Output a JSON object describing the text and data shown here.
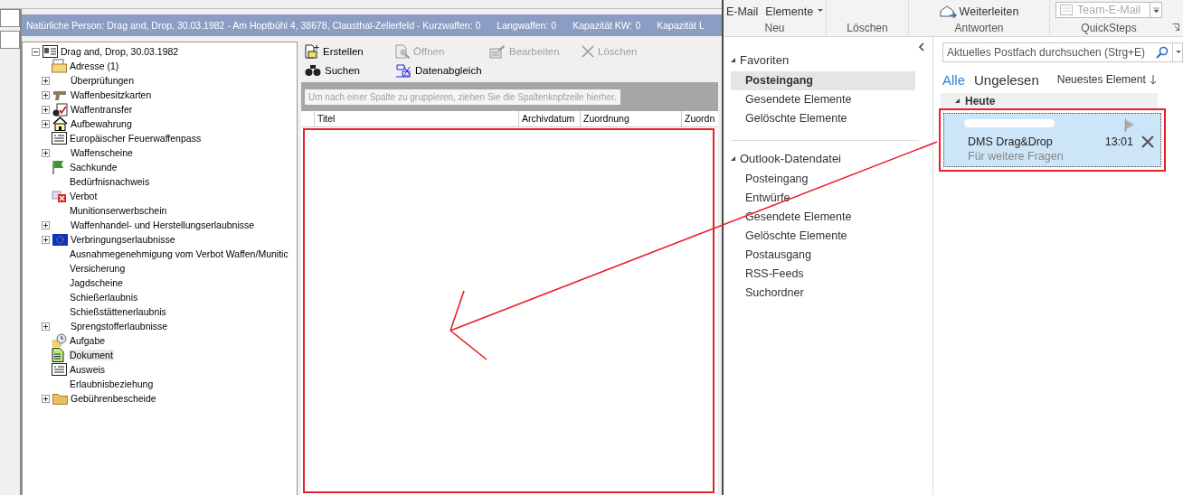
{
  "header_bar": {
    "text": "Natürliche Person: Drag and, Drop, 30.03.1982 - Am Hoptbühl 4, 38678, Clausthal-Zellerfeld - Kurzwaffen: 0",
    "extras": [
      "Langwaffen: 0",
      "Kapazität KW: 0",
      "Kapazität L"
    ]
  },
  "tree": {
    "label": "Drag and, Drop, 30.03.1982",
    "expanded": true,
    "children": [
      {
        "label": "Adresse (1)",
        "kind": "address",
        "expandable": false,
        "selected": false
      },
      {
        "label": "Überprüfungen",
        "kind": "none",
        "expandable": true,
        "selected": false
      },
      {
        "label": "Waffenbesitzkarten",
        "kind": "gun",
        "expandable": true,
        "selected": false
      },
      {
        "label": "Waffentransfer",
        "kind": "transfer",
        "expandable": true,
        "selected": false
      },
      {
        "label": "Aufbewahrung",
        "kind": "house",
        "expandable": true,
        "selected": false
      },
      {
        "label": "Europäischer Feuerwaffenpass",
        "kind": "card",
        "expandable": false,
        "selected": false
      },
      {
        "label": "Waffenscheine",
        "kind": "none",
        "expandable": true,
        "selected": false
      },
      {
        "label": "Sachkunde",
        "kind": "flag",
        "expandable": false,
        "selected": false
      },
      {
        "label": "Bedürfnisnachweis",
        "kind": "none",
        "expandable": false,
        "selected": false
      },
      {
        "label": "Verbot",
        "kind": "ban",
        "expandable": false,
        "selected": false
      },
      {
        "label": "Munitionserwerbschein",
        "kind": "none",
        "expandable": false,
        "selected": false
      },
      {
        "label": "Waffenhandel- und Herstellungserlaubnisse",
        "kind": "none",
        "expandable": true,
        "selected": false
      },
      {
        "label": "Verbringungserlaubnisse",
        "kind": "eu",
        "expandable": true,
        "selected": false
      },
      {
        "label": "Ausnahmegenehmigung vom Verbot Waffen/Munitic",
        "kind": "none",
        "expandable": false,
        "selected": false
      },
      {
        "label": "Versicherung",
        "kind": "none",
        "expandable": false,
        "selected": false
      },
      {
        "label": "Jagdscheine",
        "kind": "none",
        "expandable": false,
        "selected": false
      },
      {
        "label": "Schießerlaubnis",
        "kind": "none",
        "expandable": false,
        "selected": false
      },
      {
        "label": "Schießstättenerlaubnis",
        "kind": "none",
        "expandable": false,
        "selected": false
      },
      {
        "label": "Sprengstofferlaubnisse",
        "kind": "none",
        "expandable": true,
        "selected": false
      },
      {
        "label": "Aufgabe",
        "kind": "task",
        "expandable": false,
        "selected": false
      },
      {
        "label": "Dokument",
        "kind": "document",
        "expandable": false,
        "selected": true
      },
      {
        "label": "Ausweis",
        "kind": "card",
        "expandable": false,
        "selected": false
      },
      {
        "label": "Erlaubnisbeziehung",
        "kind": "none",
        "expandable": false,
        "selected": false
      },
      {
        "label": "Gebührenbescheide",
        "kind": "folder",
        "expandable": true,
        "selected": false
      }
    ]
  },
  "toolbar": [
    {
      "label": "Erstellen",
      "kind": "create",
      "disabled": false
    },
    {
      "label": "Öffnen",
      "kind": "open",
      "disabled": true
    },
    {
      "label": "Bearbeiten",
      "kind": "edit",
      "disabled": true
    },
    {
      "label": "Löschen",
      "kind": "delete",
      "disabled": true
    },
    {
      "label": "Suchen",
      "kind": "search",
      "disabled": false
    },
    {
      "label": "Datenabgleich",
      "kind": "sync",
      "disabled": false
    }
  ],
  "grid": {
    "group_hint": "Um nach einer Spalte zu gruppieren, ziehen Sie die Spaltenkopfzeile hierher.",
    "columns": [
      "Titel",
      "Archivdatum",
      "Zuordnung",
      "Zuordn"
    ]
  },
  "ribbon": {
    "groups": [
      {
        "label": "Neu",
        "buttons": [
          {
            "label": "E-Mail",
            "dropdown": false
          },
          {
            "label": "Elemente",
            "dropdown": true
          }
        ]
      },
      {
        "label": "Löschen"
      },
      {
        "label": "Antworten",
        "buttons": [
          {
            "label": "Weiterleiten",
            "dropdown": false
          }
        ]
      },
      {
        "label": "QuickSteps",
        "field": "Team-E-Mail"
      }
    ]
  },
  "folders": {
    "sections": [
      {
        "title": "Favoriten",
        "items": [
          {
            "label": "Posteingang",
            "selected": true
          },
          {
            "label": "Gesendete Elemente",
            "selected": false
          },
          {
            "label": "Gelöschte Elemente",
            "selected": false
          }
        ]
      },
      {
        "title": "Outlook-Datendatei",
        "items": [
          {
            "label": "Posteingang",
            "selected": false
          },
          {
            "label": "Entwürfe",
            "selected": false
          },
          {
            "label": "Gesendete Elemente",
            "selected": false
          },
          {
            "label": "Gelöschte Elemente",
            "selected": false
          },
          {
            "label": "Postausgang",
            "selected": false
          },
          {
            "label": "RSS-Feeds",
            "selected": false
          },
          {
            "label": "Suchordner",
            "selected": false
          }
        ]
      }
    ]
  },
  "mail_list": {
    "search_placeholder": "Aktuelles Postfach durchsuchen (Strg+E)",
    "filters": [
      {
        "label": "Alle",
        "selected": true
      },
      {
        "label": "Ungelesen",
        "selected": false
      }
    ],
    "sort": "Neuestes Element",
    "group": "Heute",
    "messages": [
      {
        "subject": "DMS Drag&Drop",
        "time": "13:01",
        "preview": "Für weitere Fragen",
        "selected": true
      }
    ]
  }
}
